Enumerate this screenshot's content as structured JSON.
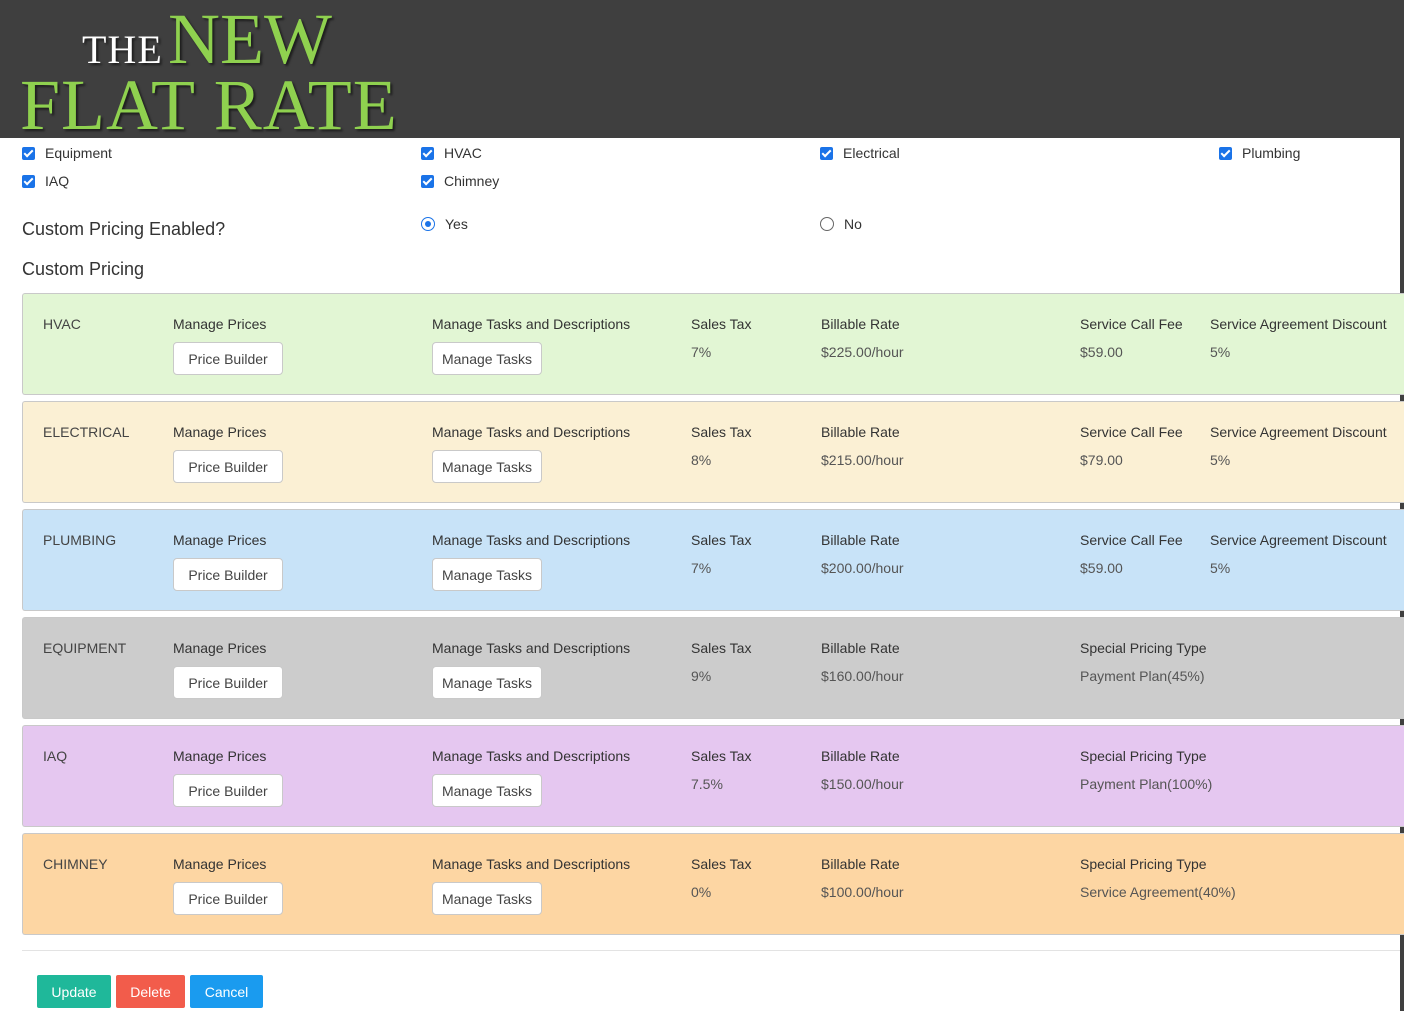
{
  "brand": {
    "the": "THE",
    "new": "NEW",
    "flat_rate": "FLAT RATE"
  },
  "categories_checks": [
    {
      "label": "Equipment",
      "checked": true
    },
    {
      "label": "HVAC",
      "checked": true
    },
    {
      "label": "Electrical",
      "checked": true
    },
    {
      "label": "Plumbing",
      "checked": true
    },
    {
      "label": "IAQ",
      "checked": true
    },
    {
      "label": "Chimney",
      "checked": true
    }
  ],
  "custom_pricing_enabled": {
    "label": "Custom Pricing Enabled?",
    "options": [
      "Yes",
      "No"
    ],
    "selected": "Yes"
  },
  "custom_pricing_title": "Custom Pricing",
  "headers": {
    "manage_prices": "Manage Prices",
    "manage_tasks": "Manage Tasks and Descriptions",
    "sales_tax": "Sales Tax",
    "billable_rate": "Billable Rate",
    "service_call_fee": "Service Call Fee",
    "service_agreement_discount": "Service Agreement Discount",
    "special_pricing_type": "Special Pricing Type",
    "price_builder_button": "Price Builder",
    "manage_tasks_button": "Manage Tasks"
  },
  "rows": [
    {
      "name": "HVAC",
      "color": "#e2f6d4",
      "sales_tax": "7%",
      "billable_rate": "$225.00/hour",
      "service_call_fee": "$59.00",
      "service_agreement_discount": "5%"
    },
    {
      "name": "ELECTRICAL",
      "color": "#fbf0d4",
      "sales_tax": "8%",
      "billable_rate": "$215.00/hour",
      "service_call_fee": "$79.00",
      "service_agreement_discount": "5%"
    },
    {
      "name": "PLUMBING",
      "color": "#c8e3f8",
      "sales_tax": "7%",
      "billable_rate": "$200.00/hour",
      "service_call_fee": "$59.00",
      "service_agreement_discount": "5%"
    },
    {
      "name": "EQUIPMENT",
      "color": "#cccccc",
      "sales_tax": "9%",
      "billable_rate": "$160.00/hour",
      "special_pricing_type": "Payment Plan(45%)"
    },
    {
      "name": "IAQ",
      "color": "#e5c7f0",
      "sales_tax": "7.5%",
      "billable_rate": "$150.00/hour",
      "special_pricing_type": "Payment Plan(100%)"
    },
    {
      "name": "CHIMNEY",
      "color": "#fdd6a3",
      "sales_tax": "0%",
      "billable_rate": "$100.00/hour",
      "special_pricing_type": "Service Agreement(40%)"
    }
  ],
  "actions": {
    "update": {
      "label": "Update",
      "color": "#1fb89a"
    },
    "delete": {
      "label": "Delete",
      "color": "#f25c4b"
    },
    "cancel": {
      "label": "Cancel",
      "color": "#1a9bef"
    }
  }
}
